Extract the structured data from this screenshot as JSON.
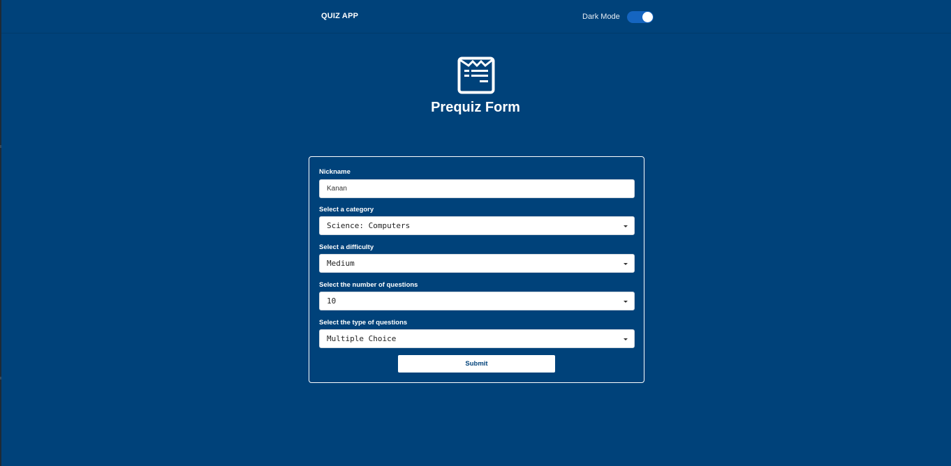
{
  "navbar": {
    "brand": "QUIZ APP",
    "dark_mode_label": "Dark Mode",
    "dark_mode_on": true
  },
  "hero": {
    "icon": "quiz-form-icon",
    "title": "Prequiz Form"
  },
  "form": {
    "nickname": {
      "label": "Nickname",
      "value": "Kanan"
    },
    "category": {
      "label": "Select a category",
      "value": "Science: Computers"
    },
    "difficulty": {
      "label": "Select a difficulty",
      "value": "Medium"
    },
    "num_questions": {
      "label": "Select the number of questions",
      "value": "10"
    },
    "question_type": {
      "label": "Select the type of questions",
      "value": "Multiple Choice"
    },
    "submit_label": "Submit"
  },
  "colors": {
    "background": "#00427a",
    "toggle_on": "#1565c0",
    "text": "#ffffff"
  }
}
